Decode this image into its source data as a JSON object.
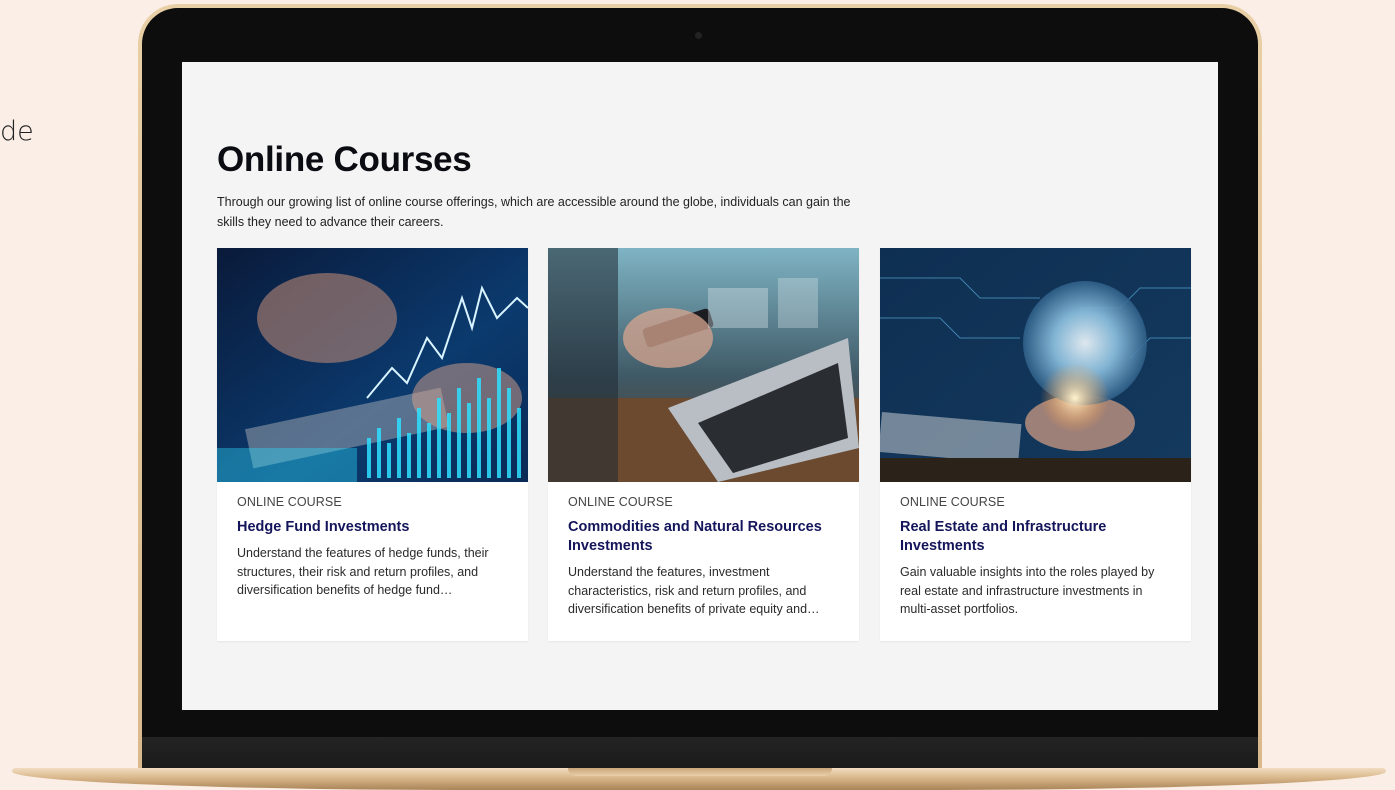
{
  "side_text": "de",
  "page": {
    "title": "Online Courses",
    "intro": "Through our growing list of online course offerings, which are accessible around the globe, individuals can gain the skills they need to advance their careers."
  },
  "cards": [
    {
      "kicker": "ONLINE COURSE",
      "title": "Hedge Fund Investments",
      "description": "Understand the features of hedge funds, their structures, their risk and return profiles, and diversification benefits of hedge fund…",
      "image_icon": "stock-chart-keyboard-image"
    },
    {
      "kicker": "ONLINE COURSE",
      "title": "Commodities and Natural Resources Investments",
      "description": "Understand the features, investment characteristics, risk and return profiles, and diversification benefits of private equity and…",
      "image_icon": "laptop-phone-image"
    },
    {
      "kicker": "ONLINE COURSE",
      "title": "Real Estate and Infrastructure Investments",
      "description": "Gain valuable insights into the roles played by real estate and infrastructure investments in multi-asset portfolios.",
      "image_icon": "globe-hands-image"
    }
  ],
  "colors": {
    "background": "#fbeee6",
    "screen": "#f4f4f5",
    "card_title": "#14155a",
    "laptop_gold": "#d9b98c"
  }
}
